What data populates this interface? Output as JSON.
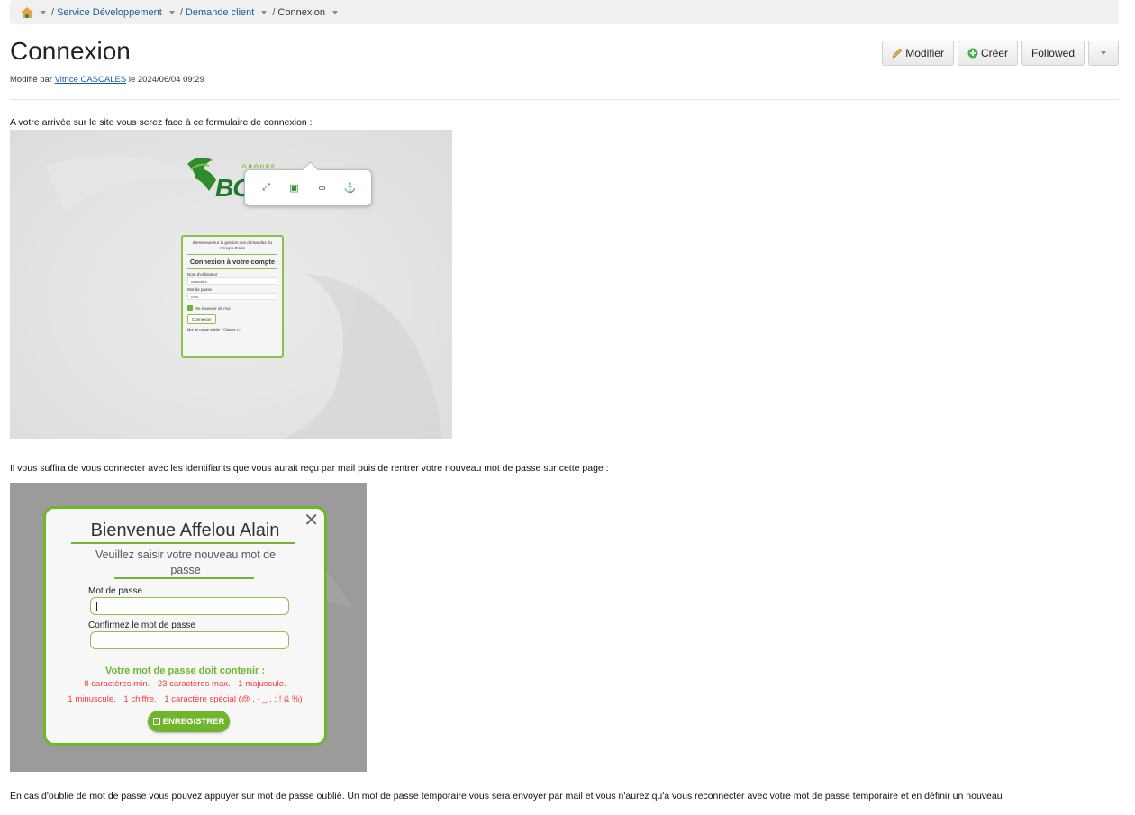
{
  "breadcrumb": {
    "items": [
      {
        "label": "Service Développement"
      },
      {
        "label": "Demande client"
      }
    ],
    "current": "Connexion",
    "separator": "/"
  },
  "page": {
    "title": "Connexion",
    "modified_prefix": "Modifié par",
    "modified_author": "Vitrice CASCALES",
    "modified_mid": "le",
    "modified_date": "2024/06/04 09:29"
  },
  "actions": {
    "edit_label": "Modifier",
    "create_label": "Créer",
    "followed_label": "Followed"
  },
  "content": {
    "para1": "A votre arrivée sur le site vous serez face à ce formulaire de connexion :",
    "para2": "Il vous suffira de vous connecter avec les identifiants que vous aurait reçu par mail puis de rentrer votre nouveau mot de passe sur cette page :",
    "para3": "En cas d'oublie de mot de passe vous pouvez appuyer sur mot de passe oublié. Un mot de passe temporaire vous sera envoyer par mail et vous n'aurez qu'a vous reconnecter avec votre mot de passe temporaire et en définir un nouveau"
  },
  "login_screenshot": {
    "logo_groupe": "GROUPE",
    "logo_text": "BO",
    "welcome": "Bienvenue sur la gestion des demandes du Groupe Bovis",
    "title": "Connexion à votre compte",
    "username_label": "Nom d'utilisateur",
    "username_value": "vcascales",
    "password_label": "Mot de passe",
    "password_value": "••••••",
    "remember_label": "Se souvenir de moi",
    "login_button": "Connexion",
    "forgot_text": "Mot de passe oublié ? Cliquez",
    "forgot_link": "ici"
  },
  "password_screenshot": {
    "title": "Bienvenue Affelou Alain",
    "subtitle": "Veuillez saisir votre nouveau mot de passe",
    "password_label": "Mot de passe",
    "confirm_label": "Confirmez le mot de passe",
    "rules_title": "Votre mot de passe doit contenir :",
    "rules_line1": [
      "8 caractères min.",
      "23 caractères max.",
      "1 majuscule."
    ],
    "rules_line2": [
      "1 minuscule.",
      "1 chiffre.",
      "1 caractère spécial (@ . - _ , ; ! & %)"
    ],
    "save_label": "ENREGISTRER",
    "close_symbol": "✕"
  },
  "colors": {
    "link": "#1a5a96",
    "brand_green": "#6fb62c",
    "error_red": "#ee3b3b"
  }
}
